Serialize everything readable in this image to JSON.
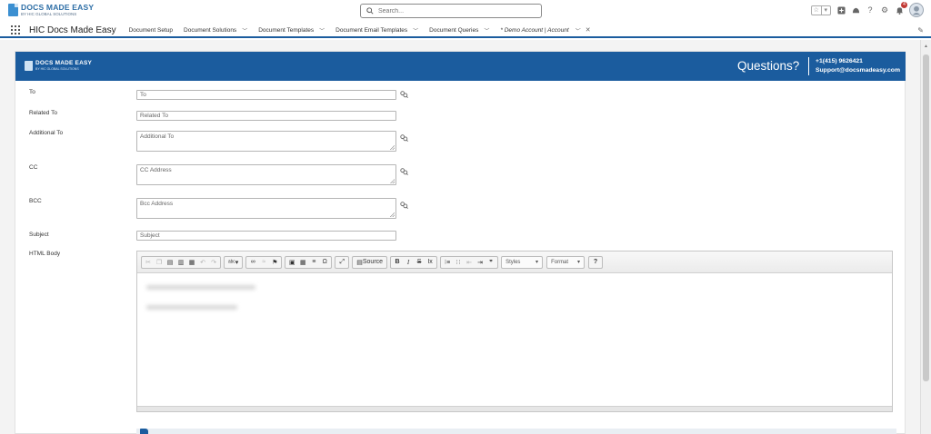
{
  "header": {
    "logo_title": "DOCS MADE EASY",
    "logo_sub": "BY HIC GLOBAL SOLUTIONS",
    "search_placeholder": "Search...",
    "notification_count": "4"
  },
  "nav": {
    "app_name": "HIC Docs Made Easy",
    "items": [
      {
        "label": "Document Setup"
      },
      {
        "label": "Document Solutions"
      },
      {
        "label": "Document Templates"
      },
      {
        "label": "Document Email Templates"
      },
      {
        "label": "Document Queries"
      },
      {
        "label": "* Demo Account | Account"
      }
    ]
  },
  "banner": {
    "logo_title": "DOCS MADE EASY",
    "logo_sub": "BY HIC GLOBAL SOLUTIONS",
    "questions": "Questions?",
    "phone": "+1(415) 9626421",
    "email": "Support@docsmadeasy.com"
  },
  "form": {
    "to": {
      "label": "To",
      "placeholder": "To"
    },
    "related_to": {
      "label": "Related To",
      "placeholder": "Related To"
    },
    "additional_to": {
      "label": "Additional To",
      "placeholder": "Additional To"
    },
    "cc": {
      "label": "CC",
      "placeholder": "CC Address"
    },
    "bcc": {
      "label": "BCC",
      "placeholder": "Bcc Address"
    },
    "subject": {
      "label": "Subject",
      "placeholder": "Subject"
    },
    "html_body": {
      "label": "HTML Body"
    }
  },
  "editor": {
    "source_label": "Source",
    "styles_label": "Styles",
    "format_label": "Format",
    "help_label": "?"
  },
  "colors": {
    "brand": "#1b5c9e",
    "logo_blue": "#3b8fd1",
    "badge_red": "#c23934"
  }
}
